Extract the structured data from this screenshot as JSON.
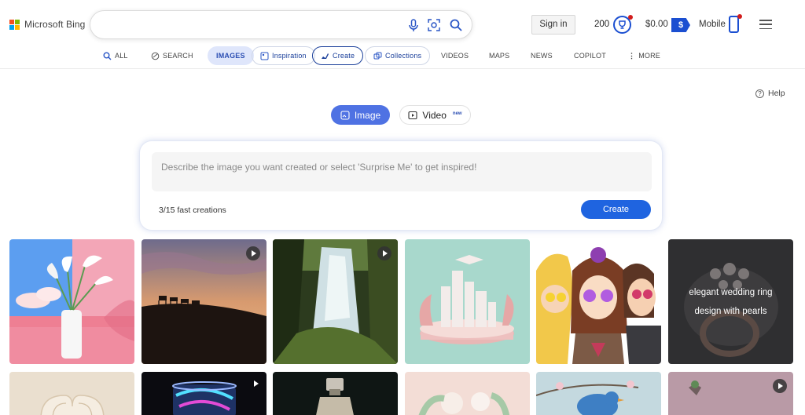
{
  "brand": {
    "name": "Microsoft Bing"
  },
  "header": {
    "signin_label": "Sign in",
    "points": "200",
    "money": "$0.00",
    "money_icon": "$",
    "mobile_label": "Mobile"
  },
  "nav": {
    "all": "ALL",
    "search": "SEARCH",
    "images": "IMAGES",
    "inspiration": "Inspiration",
    "create": "Create",
    "collections": "Collections",
    "videos": "VIDEOS",
    "maps": "MAPS",
    "news": "NEWS",
    "copilot": "COPILOT",
    "more": "MORE"
  },
  "help": {
    "label": "Help"
  },
  "mode": {
    "image": "Image",
    "video": "Video",
    "video_badge": "new"
  },
  "create_card": {
    "placeholder": "Describe the image you want created or select 'Surprise Me' to get inspired!",
    "fast_creations": "3/15 fast creations",
    "create_button": "Create"
  },
  "gallery": {
    "tile6_caption_line1": "elegant wedding ring",
    "tile6_caption_line2": "design with pearls"
  },
  "colors": {
    "accent": "#4f72e3",
    "create_button": "#1f64e0",
    "brand_blue": "#1b4fd1",
    "notification": "#d21c1c"
  }
}
